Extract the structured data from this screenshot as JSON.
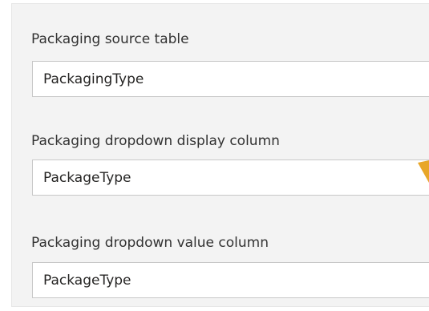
{
  "settings": {
    "fields": [
      {
        "label": "Packaging source table",
        "value": "PackagingType"
      },
      {
        "label": "Packaging dropdown display column",
        "value": "PackageType"
      },
      {
        "label": "Packaging dropdown value column",
        "value": "PackageType"
      }
    ]
  },
  "colors": {
    "panel_background": "#f3f3f3",
    "input_border": "#c8c8c8",
    "label_text": "#333333",
    "annotation_arrow": "#e8a628"
  }
}
